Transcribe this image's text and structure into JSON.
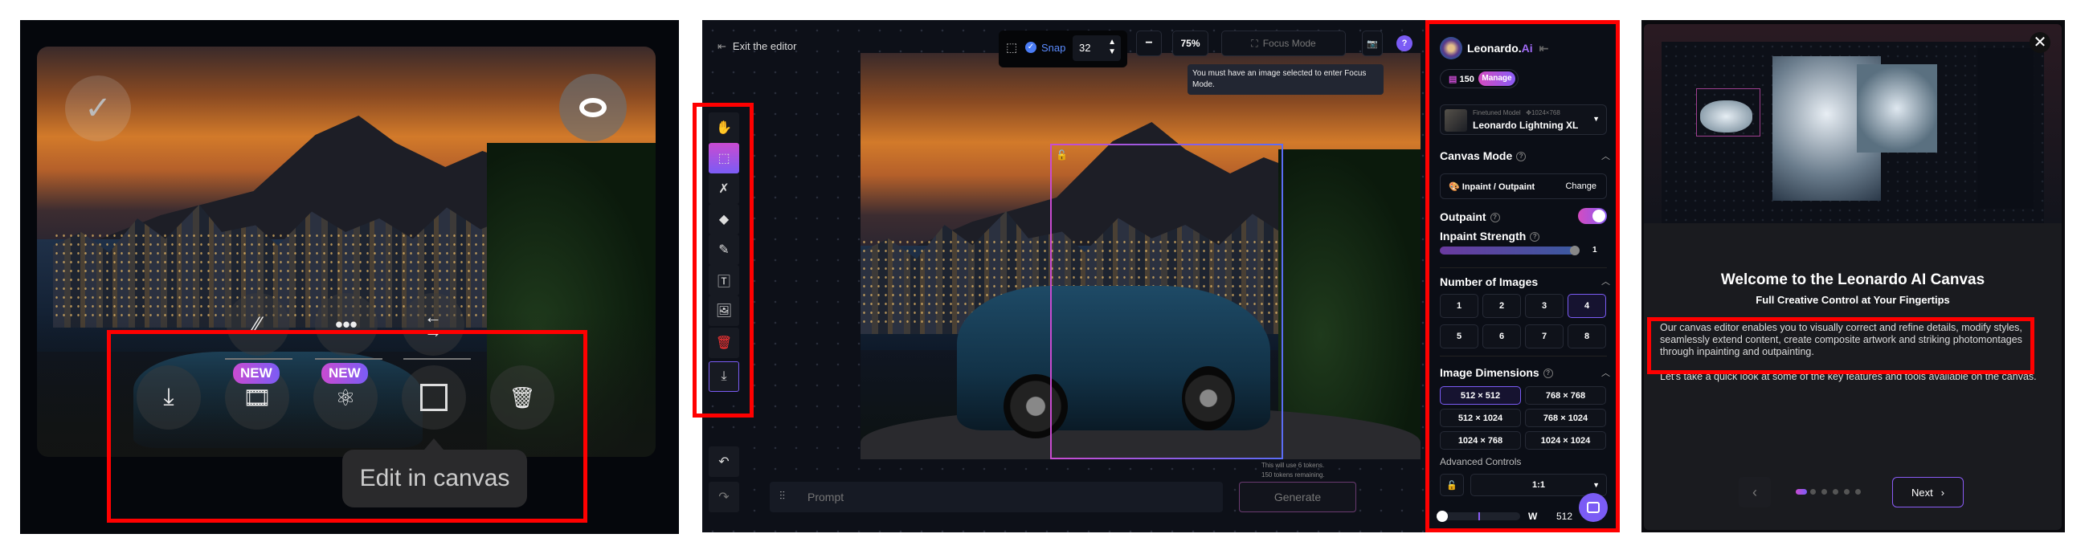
{
  "left_panel": {
    "tooltip": "Edit in canvas",
    "badge_new_1": "NEW",
    "badge_new_2": "NEW",
    "icons": [
      "check-icon",
      "eye-icon",
      "remove-background-icon",
      "more-icon",
      "swap-icon",
      "download-icon",
      "motion-icon",
      "3d-icon",
      "edit-canvas-icon",
      "trash-icon"
    ]
  },
  "editor": {
    "exit_label": "Exit the editor",
    "snap_label": "Snap",
    "snap_value": "32",
    "zoom_level": "75%",
    "focus_mode_label": "Focus Mode",
    "help_label": "?",
    "focus_tooltip": "You must have an image selected to enter Focus Mode.",
    "prompt_placeholder": "Prompt",
    "generate_label": "Generate",
    "token_line1": "This will use 6 tokens.",
    "token_line2": "150 tokens remaining.",
    "tools": [
      "hand-icon",
      "select-icon",
      "eraser-magic-icon",
      "erase-icon",
      "pencil-icon",
      "text-image-icon",
      "image-upload-icon",
      "delete-icon",
      "download-icon"
    ]
  },
  "sidebar": {
    "brand": "Leonardo.",
    "brand_accent": "Ai",
    "tokens": "150",
    "manage_label": "Manage",
    "model_type": "Finetuned Model",
    "model_dims": "1024×768",
    "model_name": "Leonardo Lightning XL",
    "canvas_mode_title": "Canvas Mode",
    "canvas_mode_value": "Inpaint / Outpaint",
    "change_label": "Change",
    "outpaint_label": "Outpaint",
    "outpaint_on": true,
    "inpaint_strength_label": "Inpaint Strength",
    "inpaint_strength_value": "1",
    "num_images_title": "Number of Images",
    "num_images": [
      "1",
      "2",
      "3",
      "4",
      "5",
      "6",
      "7",
      "8"
    ],
    "num_images_selected": "4",
    "dims_title": "Image Dimensions",
    "dims": [
      "512 × 512",
      "768 × 768",
      "512 × 1024",
      "768 × 1024",
      "1024 × 768",
      "1024 × 1024"
    ],
    "dims_selected": "512 × 512",
    "advanced_title": "Advanced Controls",
    "aspect_value": "1:1",
    "width_label": "W",
    "width_value": "512"
  },
  "modal": {
    "title": "Welcome to the Leonardo AI Canvas",
    "subtitle": "Full Creative Control at Your Fingertips",
    "para1": "Our canvas editor enables you to visually correct and refine details, modify styles, seamlessly extend content, create composite artwork and striking photomontages through inpainting and outpainting.",
    "para2": "Let's take a quick look at some of the key features and tools available on the canvas.",
    "next_label": "Next",
    "step": 1,
    "steps": 6
  },
  "colors": {
    "accent": "#7b5cf5",
    "highlight": "#ff0000",
    "brand_pink": "#c94bd1"
  }
}
